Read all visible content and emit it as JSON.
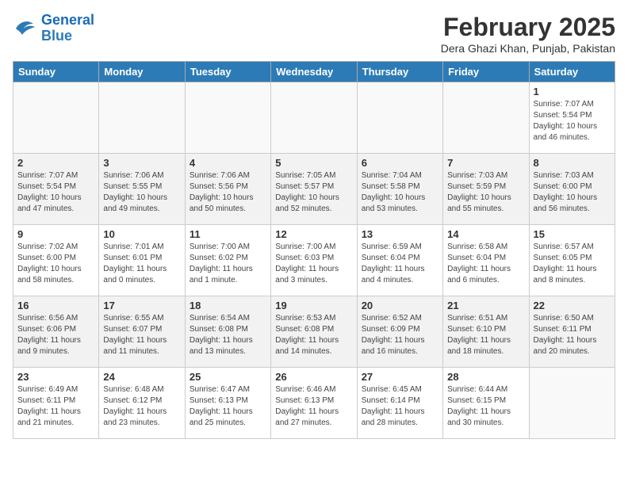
{
  "header": {
    "logo_line1": "General",
    "logo_line2": "Blue",
    "month": "February 2025",
    "location": "Dera Ghazi Khan, Punjab, Pakistan"
  },
  "weekdays": [
    "Sunday",
    "Monday",
    "Tuesday",
    "Wednesday",
    "Thursday",
    "Friday",
    "Saturday"
  ],
  "weeks": [
    [
      {
        "day": "",
        "info": ""
      },
      {
        "day": "",
        "info": ""
      },
      {
        "day": "",
        "info": ""
      },
      {
        "day": "",
        "info": ""
      },
      {
        "day": "",
        "info": ""
      },
      {
        "day": "",
        "info": ""
      },
      {
        "day": "1",
        "info": "Sunrise: 7:07 AM\nSunset: 5:54 PM\nDaylight: 10 hours\nand 46 minutes."
      }
    ],
    [
      {
        "day": "2",
        "info": "Sunrise: 7:07 AM\nSunset: 5:54 PM\nDaylight: 10 hours\nand 47 minutes."
      },
      {
        "day": "3",
        "info": "Sunrise: 7:06 AM\nSunset: 5:55 PM\nDaylight: 10 hours\nand 49 minutes."
      },
      {
        "day": "4",
        "info": "Sunrise: 7:06 AM\nSunset: 5:56 PM\nDaylight: 10 hours\nand 50 minutes."
      },
      {
        "day": "5",
        "info": "Sunrise: 7:05 AM\nSunset: 5:57 PM\nDaylight: 10 hours\nand 52 minutes."
      },
      {
        "day": "6",
        "info": "Sunrise: 7:04 AM\nSunset: 5:58 PM\nDaylight: 10 hours\nand 53 minutes."
      },
      {
        "day": "7",
        "info": "Sunrise: 7:03 AM\nSunset: 5:59 PM\nDaylight: 10 hours\nand 55 minutes."
      },
      {
        "day": "8",
        "info": "Sunrise: 7:03 AM\nSunset: 6:00 PM\nDaylight: 10 hours\nand 56 minutes."
      }
    ],
    [
      {
        "day": "9",
        "info": "Sunrise: 7:02 AM\nSunset: 6:00 PM\nDaylight: 10 hours\nand 58 minutes."
      },
      {
        "day": "10",
        "info": "Sunrise: 7:01 AM\nSunset: 6:01 PM\nDaylight: 11 hours\nand 0 minutes."
      },
      {
        "day": "11",
        "info": "Sunrise: 7:00 AM\nSunset: 6:02 PM\nDaylight: 11 hours\nand 1 minute."
      },
      {
        "day": "12",
        "info": "Sunrise: 7:00 AM\nSunset: 6:03 PM\nDaylight: 11 hours\nand 3 minutes."
      },
      {
        "day": "13",
        "info": "Sunrise: 6:59 AM\nSunset: 6:04 PM\nDaylight: 11 hours\nand 4 minutes."
      },
      {
        "day": "14",
        "info": "Sunrise: 6:58 AM\nSunset: 6:04 PM\nDaylight: 11 hours\nand 6 minutes."
      },
      {
        "day": "15",
        "info": "Sunrise: 6:57 AM\nSunset: 6:05 PM\nDaylight: 11 hours\nand 8 minutes."
      }
    ],
    [
      {
        "day": "16",
        "info": "Sunrise: 6:56 AM\nSunset: 6:06 PM\nDaylight: 11 hours\nand 9 minutes."
      },
      {
        "day": "17",
        "info": "Sunrise: 6:55 AM\nSunset: 6:07 PM\nDaylight: 11 hours\nand 11 minutes."
      },
      {
        "day": "18",
        "info": "Sunrise: 6:54 AM\nSunset: 6:08 PM\nDaylight: 11 hours\nand 13 minutes."
      },
      {
        "day": "19",
        "info": "Sunrise: 6:53 AM\nSunset: 6:08 PM\nDaylight: 11 hours\nand 14 minutes."
      },
      {
        "day": "20",
        "info": "Sunrise: 6:52 AM\nSunset: 6:09 PM\nDaylight: 11 hours\nand 16 minutes."
      },
      {
        "day": "21",
        "info": "Sunrise: 6:51 AM\nSunset: 6:10 PM\nDaylight: 11 hours\nand 18 minutes."
      },
      {
        "day": "22",
        "info": "Sunrise: 6:50 AM\nSunset: 6:11 PM\nDaylight: 11 hours\nand 20 minutes."
      }
    ],
    [
      {
        "day": "23",
        "info": "Sunrise: 6:49 AM\nSunset: 6:11 PM\nDaylight: 11 hours\nand 21 minutes."
      },
      {
        "day": "24",
        "info": "Sunrise: 6:48 AM\nSunset: 6:12 PM\nDaylight: 11 hours\nand 23 minutes."
      },
      {
        "day": "25",
        "info": "Sunrise: 6:47 AM\nSunset: 6:13 PM\nDaylight: 11 hours\nand 25 minutes."
      },
      {
        "day": "26",
        "info": "Sunrise: 6:46 AM\nSunset: 6:13 PM\nDaylight: 11 hours\nand 27 minutes."
      },
      {
        "day": "27",
        "info": "Sunrise: 6:45 AM\nSunset: 6:14 PM\nDaylight: 11 hours\nand 28 minutes."
      },
      {
        "day": "28",
        "info": "Sunrise: 6:44 AM\nSunset: 6:15 PM\nDaylight: 11 hours\nand 30 minutes."
      },
      {
        "day": "",
        "info": ""
      }
    ]
  ]
}
